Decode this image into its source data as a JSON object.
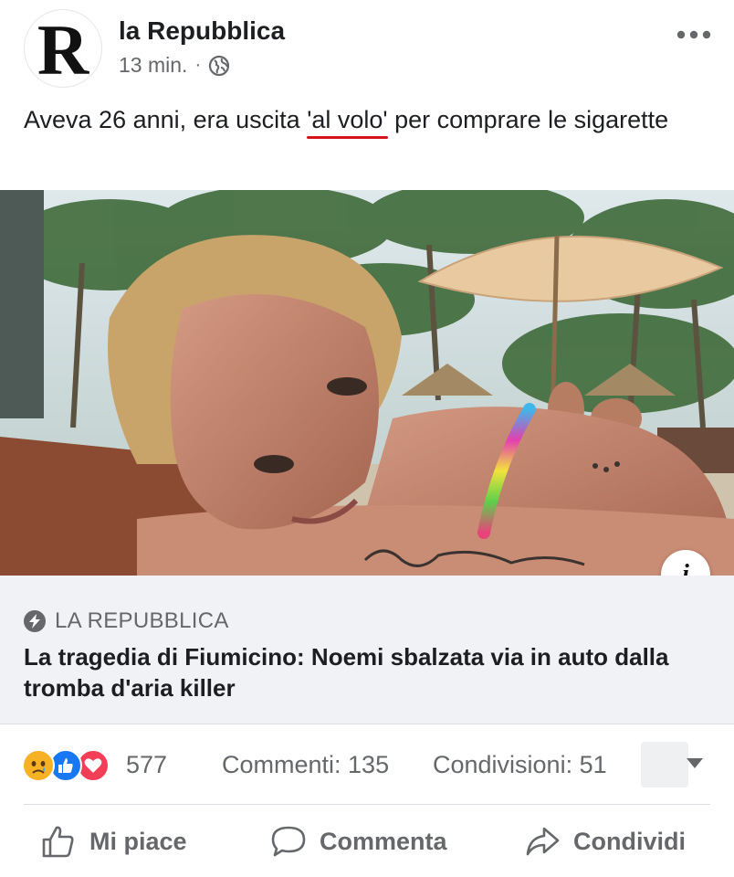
{
  "post": {
    "page_name": "la Repubblica",
    "avatar_letter": "R",
    "time": "13 min.",
    "separator": "·",
    "privacy_icon": "globe-icon",
    "more_icon": "more-horizontal-icon",
    "text_before": "Aveva 26 anni, era uscita ",
    "text_highlight": "'al volo'",
    "text_after": " per comprare le sigarette",
    "highlight_color": "#d6121b"
  },
  "photo": {
    "info_label": "i"
  },
  "link_preview": {
    "source": "LA REPUBBLICA",
    "title": "La tragedia di Fiumicino: Noemi sbalzata via in auto dalla tromba d'aria killer"
  },
  "stats": {
    "reaction_icons": [
      "sad-reaction-icon",
      "like-reaction-icon",
      "love-reaction-icon"
    ],
    "reaction_count": "577",
    "comments": "Commenti: 135",
    "shares": "Condivisioni: 51"
  },
  "actions": {
    "like": "Mi piace",
    "comment": "Commenta",
    "share": "Condividi"
  },
  "colors": {
    "text_primary": "#1c1e21",
    "text_secondary": "#65676b",
    "link_box_bg": "#f0f2f5",
    "like_blue": "#1877f2",
    "love_red": "#f33e58",
    "sad_yellow": "#f7b125"
  }
}
